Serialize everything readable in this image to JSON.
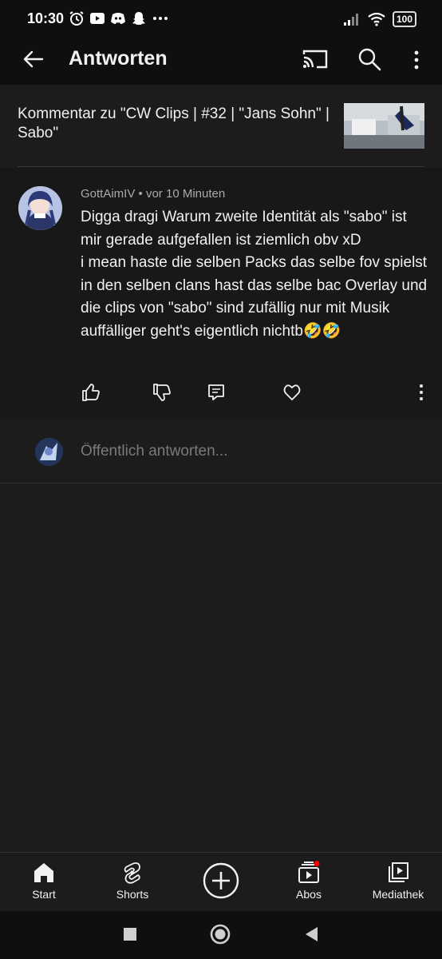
{
  "status": {
    "time": "10:30",
    "battery": "100",
    "left_icons": [
      "alarm-icon",
      "youtube-icon",
      "discord-icon",
      "snapchat-icon",
      "more-dots-icon"
    ],
    "right_icons": [
      "signal-icon",
      "wifi-icon",
      "battery-icon"
    ]
  },
  "header": {
    "title": "Antworten",
    "icons": [
      "back-arrow-icon",
      "cast-icon",
      "search-icon",
      "more-vert-icon"
    ]
  },
  "context": {
    "text": "Kommentar zu \"CW Clips | #32 | \"Jans Sohn\" | Sabo\""
  },
  "comment": {
    "author": "GottAimIV",
    "separator": "•",
    "time": "vor 10 Minuten",
    "text": "Digga dragi Warum zweite Identität als \"sabo\" ist mir gerade aufgefallen ist ziemlich obv xD\ni mean haste die selben Packs das selbe fov spielst in den selben clans hast das selbe bac Overlay und die clips von \"sabo\" sind zufällig nur mit Musik auffälliger geht's eigentlich nichtb🤣🤣",
    "actions": [
      "like-icon",
      "dislike-icon",
      "reply-icon",
      "heart-icon",
      "more-vert-icon"
    ]
  },
  "reply": {
    "placeholder": "Öffentlich antworten..."
  },
  "bottom_nav": {
    "items": [
      {
        "label": "Start",
        "icon": "home-icon"
      },
      {
        "label": "Shorts",
        "icon": "shorts-icon"
      },
      {
        "label": "",
        "icon": "add-icon"
      },
      {
        "label": "Abos",
        "icon": "subscriptions-icon"
      },
      {
        "label": "Mediathek",
        "icon": "library-icon"
      }
    ],
    "notification_dot_color": "#ff0000"
  },
  "system_nav": {
    "icons": [
      "recents-square-icon",
      "home-circle-icon",
      "back-triangle-icon"
    ]
  },
  "colors": {
    "background": "#1c1c1c",
    "bar": "#0f0f0f",
    "text": "#f1f1f1",
    "secondary_text": "#aaaaaa"
  }
}
